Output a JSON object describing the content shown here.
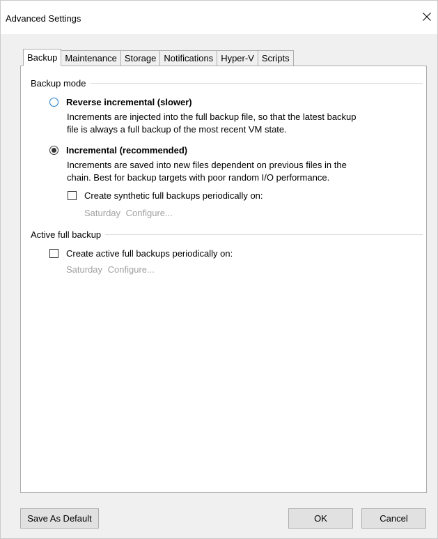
{
  "window": {
    "title": "Advanced Settings",
    "close_glyph": "×"
  },
  "tabs": [
    {
      "label": "Backup",
      "active": true
    },
    {
      "label": "Maintenance",
      "active": false
    },
    {
      "label": "Storage",
      "active": false
    },
    {
      "label": "Notifications",
      "active": false
    },
    {
      "label": "Hyper-V",
      "active": false
    },
    {
      "label": "Scripts",
      "active": false
    }
  ],
  "backup_mode": {
    "header": "Backup mode",
    "reverse": {
      "label": "Reverse incremental (slower)",
      "selected": false,
      "description_line1": "Increments are injected into the full backup file, so that the latest backup",
      "description_line2": "file is always a full backup of the most recent VM state."
    },
    "incremental": {
      "label": "Incremental (recommended)",
      "selected": true,
      "description_line1": "Increments are saved into new files dependent on previous files in the",
      "description_line2": "chain. Best for backup targets with poor random I/O performance."
    },
    "synthetic": {
      "label": "Create synthetic full backups periodically on:",
      "checked": false,
      "day": "Saturday",
      "configure": "Configure..."
    }
  },
  "active_full": {
    "header": "Active full backup",
    "checkbox": {
      "label": "Create active full backups periodically on:",
      "checked": false,
      "day": "Saturday",
      "configure": "Configure..."
    }
  },
  "buttons": {
    "save_default": "Save As Default",
    "ok": "OK",
    "cancel": "Cancel"
  },
  "colors": {
    "window_bg": "#f0f0f0",
    "panel_bg": "#ffffff",
    "disabled_text": "#a0a0a0",
    "radio_focus": "#1979ca"
  }
}
